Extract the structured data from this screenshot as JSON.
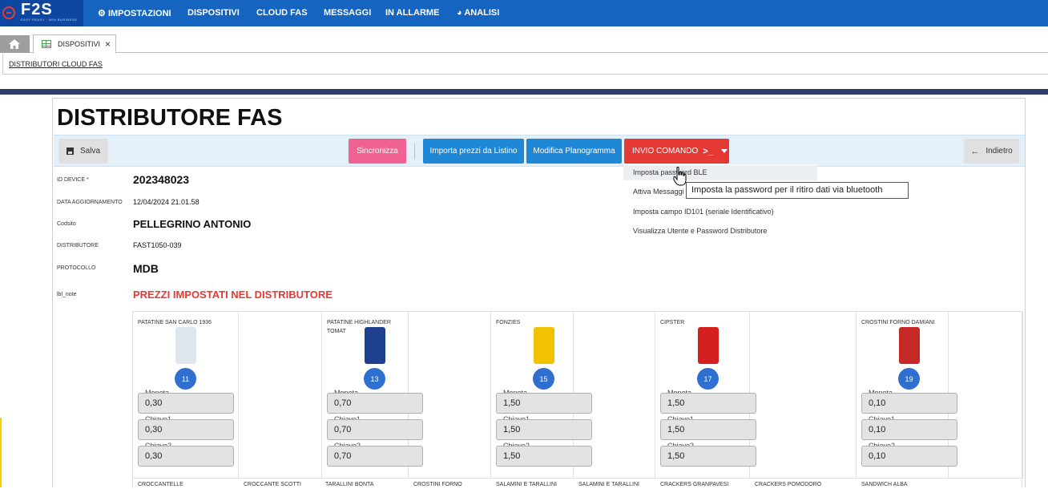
{
  "brand": {
    "logo_text": "F2S",
    "tagline": "EASY PEASY · WIN BUSINESS"
  },
  "nav": [
    {
      "label": "IMPOSTAZIONI",
      "icon": "gear-icon"
    },
    {
      "label": "DISPOSITIVI"
    },
    {
      "label": "CLOUD FAS"
    },
    {
      "label": "MESSAGGI"
    },
    {
      "label": "IN ALLARME"
    },
    {
      "label": "ANALISI",
      "icon": "pie-chart-icon"
    }
  ],
  "tabs": {
    "home_icon": "home-icon",
    "active_tab": "DISPOSITIVI",
    "close": "×"
  },
  "breadcrumb": "DISTRIBUTORI CLOUD FAS",
  "page": {
    "title": "DISTRIBUTORE FAS"
  },
  "toolbar": {
    "save": "Salva",
    "sync": "Sincronizza",
    "importa": "Importa prezzi da Listino",
    "modifica": "Modifica Planogramma",
    "invio": "INVIO COMANDO",
    "invio_icon": "terminal-icon",
    "indietro": "Indietro"
  },
  "fields": [
    {
      "label": "ID DEVICE *",
      "value": "202348023"
    },
    {
      "label": "DATA AGGIORNAMENTO",
      "value": "12/04/2024 21.01.58"
    },
    {
      "label": "Codsito",
      "value": "PELLEGRINO ANTONIO"
    },
    {
      "label": "DISTRIBUTORE",
      "value": "FAST1050-039"
    },
    {
      "label": "PROTOCOLLO",
      "value": "MDB"
    },
    {
      "label": "lbl_note",
      "value": "PREZZI IMPOSTATI NEL DISTRIBUTORE"
    }
  ],
  "dropdown": {
    "items": [
      "Imposta password BLE",
      "Attiva Messaggi",
      "Imposta campo ID101 (seriale Identificativo)",
      "Visualizza Utente e Password Distributore"
    ],
    "tooltip": "Imposta la password per il ritiro dati via bluetooth"
  },
  "price_labels": {
    "moneta": "Moneta",
    "chiave1": "Chiave1",
    "chiave2": "Chiave2"
  },
  "products": [
    {
      "name": "PATATINE SAN CARLO 1936",
      "slot": "11",
      "moneta": "0,30",
      "chiave1": "0,30",
      "chiave2": "0,30",
      "color": "#dfe7ee"
    },
    {
      "name": "PATATINE HIGHLANDER TOMAT",
      "slot": "13",
      "moneta": "0,70",
      "chiave1": "0,70",
      "chiave2": "0,70",
      "color": "#1f3f8f"
    },
    {
      "name": "FONZIES",
      "slot": "15",
      "moneta": "1,50",
      "chiave1": "1,50",
      "chiave2": "1,50",
      "color": "#f2c200"
    },
    {
      "name": "CIPSTER",
      "slot": "17",
      "moneta": "1,50",
      "chiave1": "1,50",
      "chiave2": "1,50",
      "color": "#d62020"
    },
    {
      "name": "CROSTINI FORNO DAMIANI",
      "slot": "19",
      "moneta": "0,10",
      "chiave1": "0,10",
      "chiave2": "0,10",
      "color": "#c62828"
    }
  ],
  "row2": [
    "CROCCANTELLE",
    "CROCCANTE SCOTTI",
    "TARALLINI BONTA",
    "CROSTINI FORNO",
    "SALAMINI E TARALLINI",
    "SALAMINI E TARALLINI",
    "CRACKERS GRANPAVESI",
    "CRACKERS POMODORO",
    "SANDWICH ALBA"
  ]
}
